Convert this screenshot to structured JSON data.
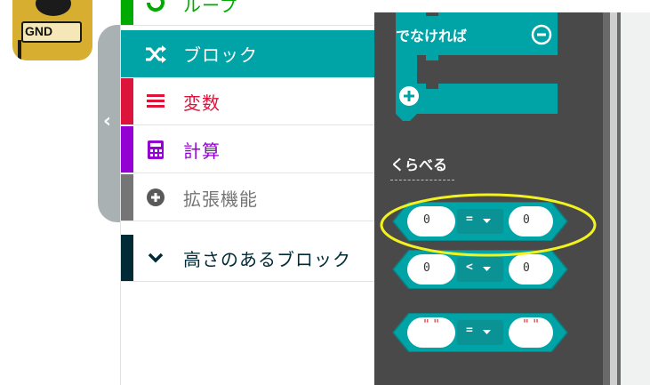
{
  "board": {
    "pin_label": "GND"
  },
  "toolbox": {
    "categories": [
      {
        "label": "ループ",
        "color": "#00aa00",
        "icon": "loop-icon"
      },
      {
        "label": "ブロック",
        "color": "#00a4a6",
        "icon": "shuffle-icon",
        "selected": true
      },
      {
        "label": "変数",
        "color": "#dc143c",
        "icon": "list-icon"
      },
      {
        "label": "計算",
        "color": "#9400d3",
        "icon": "calculator-icon"
      },
      {
        "label": "拡張機能",
        "color": "#757575",
        "icon": "plus-circle-icon"
      },
      {
        "label": "高さのあるブロック",
        "color": "#002b36",
        "icon": "chevron-down-icon"
      }
    ]
  },
  "flyout": {
    "else_label": "でなければ",
    "section_title": "くらべる",
    "compare_blocks": [
      {
        "left": "0",
        "op": "=",
        "right": "0"
      },
      {
        "left": "0",
        "op": "<",
        "right": "0"
      },
      {
        "left": "\" \"",
        "op": "=",
        "right": "\" \""
      }
    ]
  },
  "colors": {
    "logic_block": "#00a4a6",
    "flyout_bg": "#494949",
    "highlight": "#f2f21e"
  }
}
